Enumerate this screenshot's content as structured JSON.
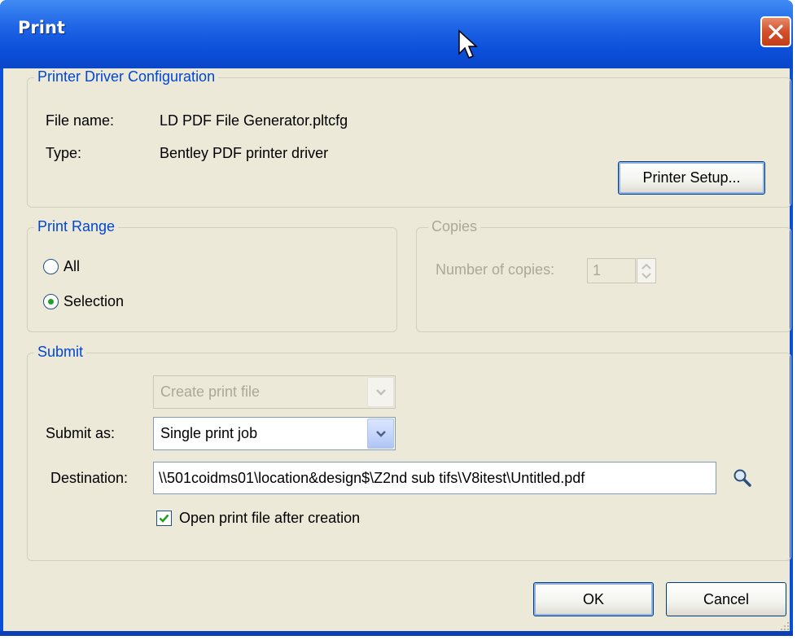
{
  "window": {
    "title": "Print"
  },
  "driver_config": {
    "legend": "Printer Driver Configuration",
    "file_name_label": "File name:",
    "file_name_value": "LD PDF File Generator.pltcfg",
    "type_label": "Type:",
    "type_value": "Bentley PDF printer driver",
    "printer_setup_label": "Printer Setup..."
  },
  "print_range": {
    "legend": "Print Range",
    "options": [
      {
        "label": "All",
        "selected": false
      },
      {
        "label": "Selection",
        "selected": true
      }
    ]
  },
  "copies": {
    "legend": "Copies",
    "number_label": "Number of copies:",
    "number_value": "1",
    "enabled": false
  },
  "submit": {
    "legend": "Submit",
    "create_value": "Create print file",
    "submit_as_label": "Submit as:",
    "submit_as_value": "Single print job",
    "destination_label": "Destination:",
    "destination_value": "\\\\501coidms01\\location&design$\\Z2nd sub tifs\\V8itest\\Untitled.pdf",
    "open_after_label": "Open print file after creation",
    "open_after_checked": true
  },
  "buttons": {
    "ok": "OK",
    "cancel": "Cancel"
  },
  "colors": {
    "titlebar": "#0a4fd8",
    "dialog": "#ece9d8",
    "group_legend": "#0046d5",
    "close": "#d2502c"
  },
  "icons": {
    "close": "close-icon",
    "browse": "magnifier-icon",
    "cursor": "mouse-pointer-icon"
  }
}
